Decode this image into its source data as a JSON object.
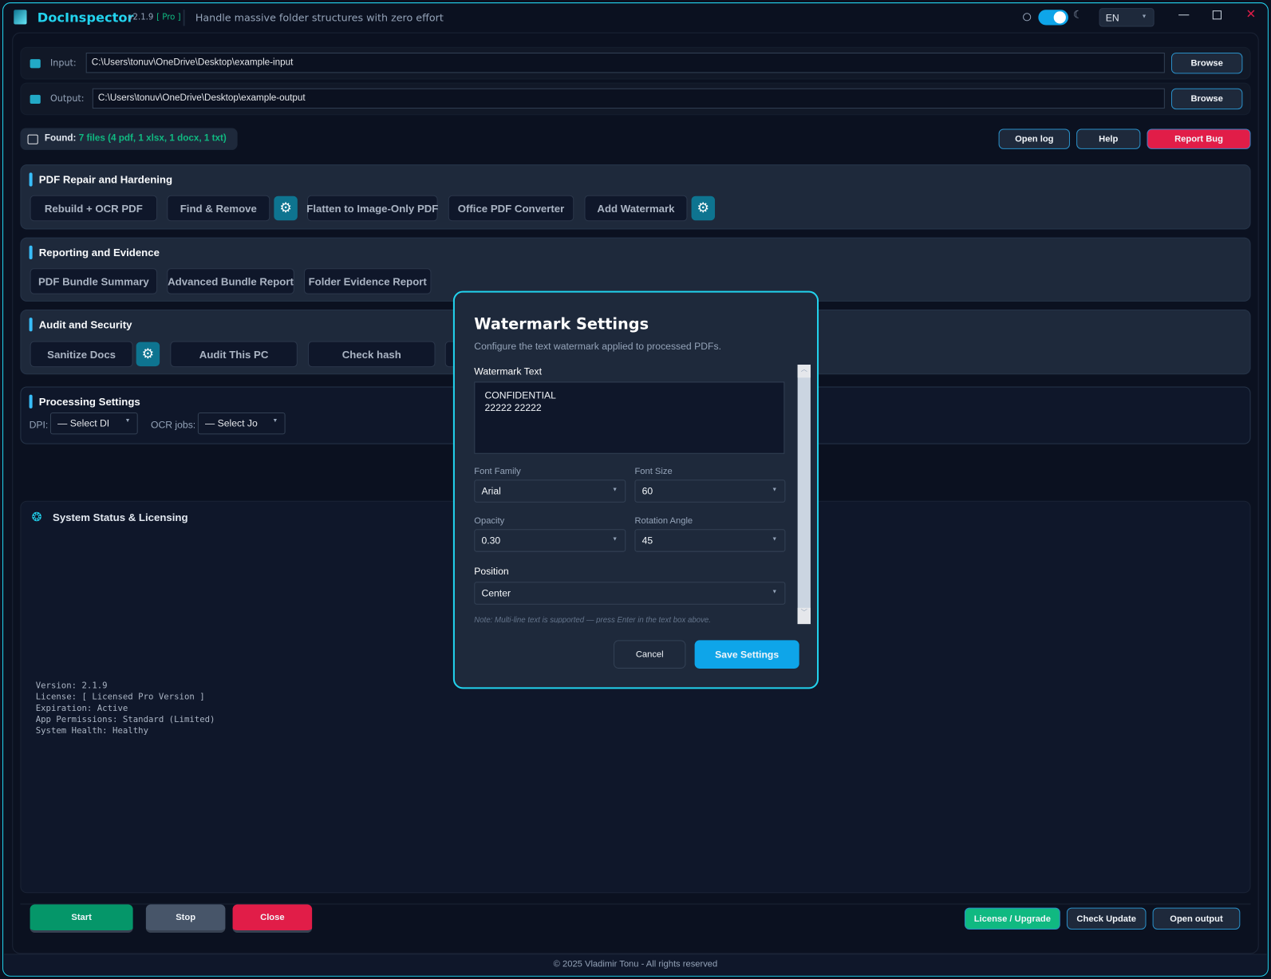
{
  "app": {
    "title": "DocInspector",
    "version": "v2.1.9",
    "edition": "[ Pro ]",
    "tagline": "Handle massive folder structures with zero effort",
    "language": "EN",
    "theme_dark": true
  },
  "paths": {
    "input_label": "Input:",
    "input_value": "C:\\Users\\tonuv\\OneDrive\\Desktop\\example-input",
    "output_label": "Output:",
    "output_value": "C:\\Users\\tonuv\\OneDrive\\Desktop\\example-output",
    "browse": "Browse"
  },
  "found": {
    "label": "Found:",
    "value": "7 files (4 pdf, 1 xlsx, 1 docx, 1 txt)"
  },
  "top_buttons": {
    "open_log": "Open log",
    "help": "Help",
    "report_bug": "Report Bug"
  },
  "sections": {
    "repair": {
      "title": "PDF Repair and Hardening",
      "buttons": [
        "Rebuild + OCR PDF",
        "Find & Remove",
        "Flatten to Image-Only PDF",
        "Office PDF Converter",
        "Add Watermark"
      ]
    },
    "reporting": {
      "title": "Reporting and Evidence",
      "buttons": [
        "PDF Bundle Summary",
        "Advanced Bundle Report",
        "Folder Evidence Report"
      ]
    },
    "audit": {
      "title": "Audit and Security",
      "buttons": [
        "Sanitize Docs",
        "Audit This PC",
        "Check hash"
      ]
    },
    "processing": {
      "title": "Processing Settings",
      "dpi_label": "DPI:",
      "dpi_value": "— Select DI",
      "ocr_label": "OCR jobs:",
      "ocr_value": "— Select Jo"
    }
  },
  "status": {
    "title": "System Status & Licensing",
    "lines": [
      "Version: 2.1.9",
      "License: [ Licensed Pro Version ]",
      "Expiration: Active",
      "App Permissions: Standard (Limited)",
      "System Health: Healthy"
    ]
  },
  "bottom": {
    "start": "Start",
    "stop": "Stop",
    "close": "Close",
    "license": "License / Upgrade",
    "check_update": "Check Update",
    "open_output": "Open output"
  },
  "footer": "© 2025 Vladimir Tonu - All rights reserved",
  "modal": {
    "title": "Watermark Settings",
    "subtitle": "Configure the text watermark applied to processed PDFs.",
    "text_label": "Watermark Text",
    "text_value": "CONFIDENTIAL\n22222 22222",
    "font_family_label": "Font Family",
    "font_family": "Arial",
    "font_size_label": "Font Size",
    "font_size": "60",
    "opacity_label": "Opacity",
    "opacity": "0.30",
    "rotation_label": "Rotation Angle",
    "rotation": "45",
    "position_label": "Position",
    "position": "Center",
    "note": "Note: Multi-line text is supported — press Enter in the text box above.",
    "cancel": "Cancel",
    "save": "Save Settings"
  },
  "colors": {
    "accent": "#22d3ee",
    "primary": "#0ea5e9",
    "danger": "#e11d48",
    "success": "#059669"
  }
}
